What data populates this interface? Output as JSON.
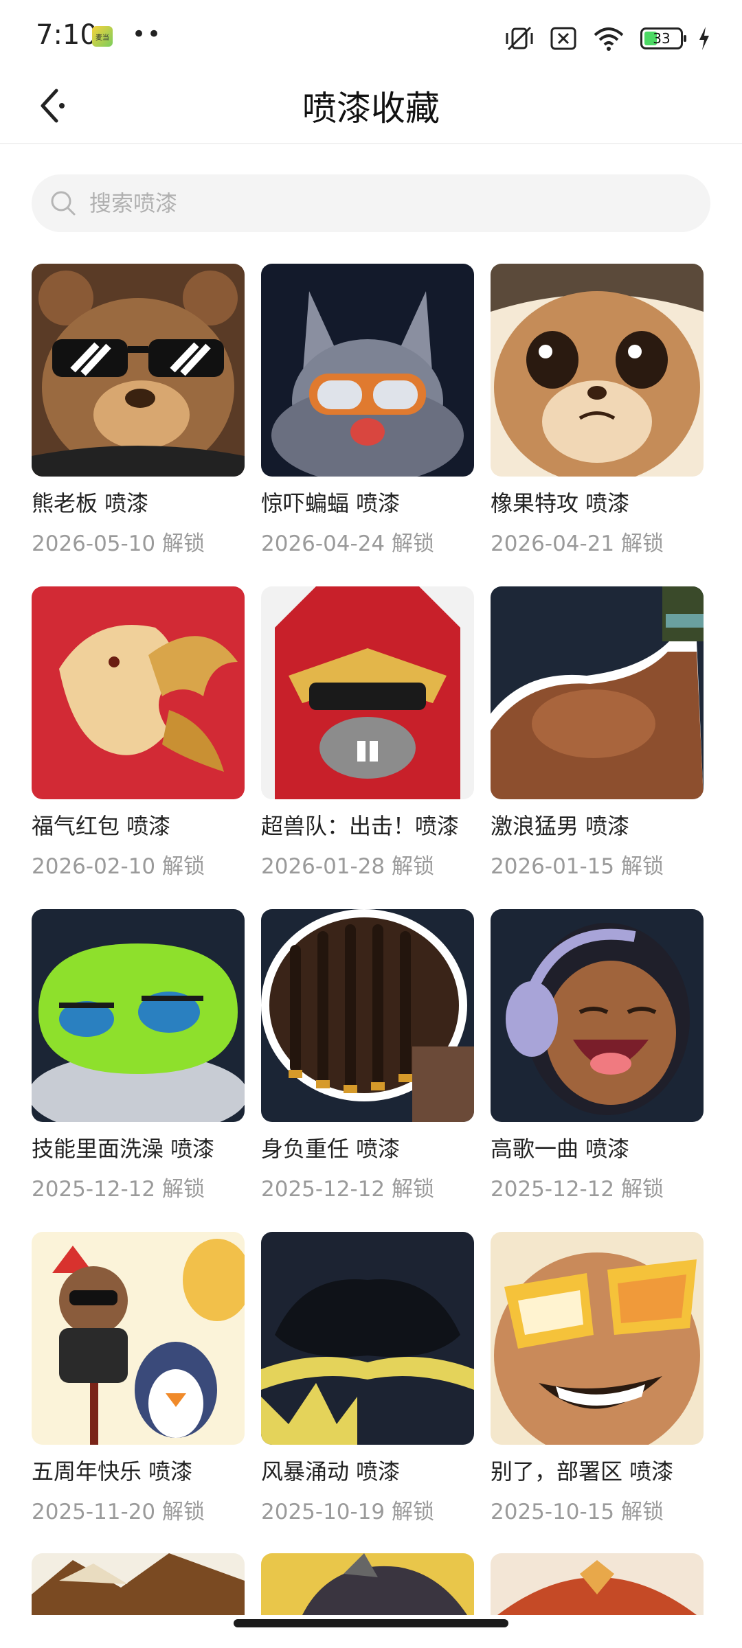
{
  "status_bar": {
    "time": "7:10",
    "app_badge": "麦当",
    "dots": "••",
    "battery_level": "33"
  },
  "header": {
    "title": "喷漆收藏"
  },
  "search": {
    "placeholder": "搜索喷漆"
  },
  "colors": {
    "accent_title": "#111111",
    "date_gray": "#9a9a9a",
    "search_bg": "#f4f4f4"
  },
  "sprays": [
    {
      "title": "熊老板 喷漆",
      "date": "2026-05-10 解锁",
      "icon": "boss-bear-image"
    },
    {
      "title": "惊吓蝙蝠 喷漆",
      "date": "2026-04-24 解锁",
      "icon": "scared-bat-image"
    },
    {
      "title": "橡果特攻 喷漆",
      "date": "2026-04-21 解锁",
      "icon": "acorn-squirrel-image"
    },
    {
      "title": "福气红包 喷漆",
      "date": "2026-02-10 解锁",
      "icon": "lucky-horse-image"
    },
    {
      "title": "超兽队：出击！喷漆",
      "date": "2026-01-28 解锁",
      "icon": "red-hero-image"
    },
    {
      "title": "激浪猛男 喷漆",
      "date": "2026-01-15 解锁",
      "icon": "muscle-arm-image"
    },
    {
      "title": "技能里面洗澡 喷漆",
      "date": "2025-12-12 解锁",
      "icon": "green-slime-image"
    },
    {
      "title": "身负重任 喷漆",
      "date": "2025-12-12 解锁",
      "icon": "dreadlocks-image"
    },
    {
      "title": "高歌一曲 喷漆",
      "date": "2025-12-12 解锁",
      "icon": "singer-headphones-image"
    },
    {
      "title": "五周年快乐 喷漆",
      "date": "2025-11-20 解锁",
      "icon": "anniversary-bear-penguin-image"
    },
    {
      "title": "风暴涌动 喷漆",
      "date": "2025-10-19 解锁",
      "icon": "storm-crown-image"
    },
    {
      "title": "别了，部署区 喷漆",
      "date": "2025-10-15 解锁",
      "icon": "sunglasses-grin-image"
    }
  ]
}
